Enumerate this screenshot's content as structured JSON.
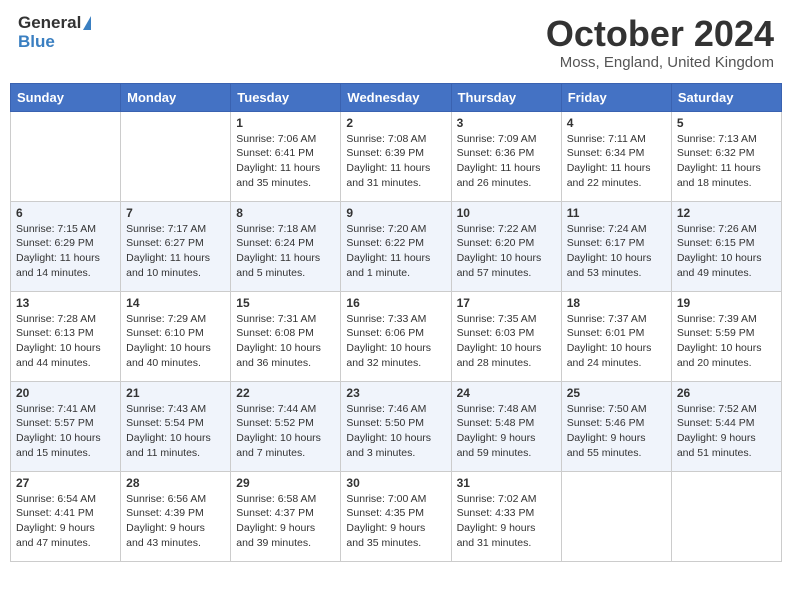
{
  "header": {
    "logo_general": "General",
    "logo_blue": "Blue",
    "title": "October 2024",
    "location": "Moss, England, United Kingdom"
  },
  "weekdays": [
    "Sunday",
    "Monday",
    "Tuesday",
    "Wednesday",
    "Thursday",
    "Friday",
    "Saturday"
  ],
  "weeks": [
    [
      {
        "day": "",
        "sunrise": "",
        "sunset": "",
        "daylight": ""
      },
      {
        "day": "",
        "sunrise": "",
        "sunset": "",
        "daylight": ""
      },
      {
        "day": "1",
        "sunrise": "Sunrise: 7:06 AM",
        "sunset": "Sunset: 6:41 PM",
        "daylight": "Daylight: 11 hours and 35 minutes."
      },
      {
        "day": "2",
        "sunrise": "Sunrise: 7:08 AM",
        "sunset": "Sunset: 6:39 PM",
        "daylight": "Daylight: 11 hours and 31 minutes."
      },
      {
        "day": "3",
        "sunrise": "Sunrise: 7:09 AM",
        "sunset": "Sunset: 6:36 PM",
        "daylight": "Daylight: 11 hours and 26 minutes."
      },
      {
        "day": "4",
        "sunrise": "Sunrise: 7:11 AM",
        "sunset": "Sunset: 6:34 PM",
        "daylight": "Daylight: 11 hours and 22 minutes."
      },
      {
        "day": "5",
        "sunrise": "Sunrise: 7:13 AM",
        "sunset": "Sunset: 6:32 PM",
        "daylight": "Daylight: 11 hours and 18 minutes."
      }
    ],
    [
      {
        "day": "6",
        "sunrise": "Sunrise: 7:15 AM",
        "sunset": "Sunset: 6:29 PM",
        "daylight": "Daylight: 11 hours and 14 minutes."
      },
      {
        "day": "7",
        "sunrise": "Sunrise: 7:17 AM",
        "sunset": "Sunset: 6:27 PM",
        "daylight": "Daylight: 11 hours and 10 minutes."
      },
      {
        "day": "8",
        "sunrise": "Sunrise: 7:18 AM",
        "sunset": "Sunset: 6:24 PM",
        "daylight": "Daylight: 11 hours and 5 minutes."
      },
      {
        "day": "9",
        "sunrise": "Sunrise: 7:20 AM",
        "sunset": "Sunset: 6:22 PM",
        "daylight": "Daylight: 11 hours and 1 minute."
      },
      {
        "day": "10",
        "sunrise": "Sunrise: 7:22 AM",
        "sunset": "Sunset: 6:20 PM",
        "daylight": "Daylight: 10 hours and 57 minutes."
      },
      {
        "day": "11",
        "sunrise": "Sunrise: 7:24 AM",
        "sunset": "Sunset: 6:17 PM",
        "daylight": "Daylight: 10 hours and 53 minutes."
      },
      {
        "day": "12",
        "sunrise": "Sunrise: 7:26 AM",
        "sunset": "Sunset: 6:15 PM",
        "daylight": "Daylight: 10 hours and 49 minutes."
      }
    ],
    [
      {
        "day": "13",
        "sunrise": "Sunrise: 7:28 AM",
        "sunset": "Sunset: 6:13 PM",
        "daylight": "Daylight: 10 hours and 44 minutes."
      },
      {
        "day": "14",
        "sunrise": "Sunrise: 7:29 AM",
        "sunset": "Sunset: 6:10 PM",
        "daylight": "Daylight: 10 hours and 40 minutes."
      },
      {
        "day": "15",
        "sunrise": "Sunrise: 7:31 AM",
        "sunset": "Sunset: 6:08 PM",
        "daylight": "Daylight: 10 hours and 36 minutes."
      },
      {
        "day": "16",
        "sunrise": "Sunrise: 7:33 AM",
        "sunset": "Sunset: 6:06 PM",
        "daylight": "Daylight: 10 hours and 32 minutes."
      },
      {
        "day": "17",
        "sunrise": "Sunrise: 7:35 AM",
        "sunset": "Sunset: 6:03 PM",
        "daylight": "Daylight: 10 hours and 28 minutes."
      },
      {
        "day": "18",
        "sunrise": "Sunrise: 7:37 AM",
        "sunset": "Sunset: 6:01 PM",
        "daylight": "Daylight: 10 hours and 24 minutes."
      },
      {
        "day": "19",
        "sunrise": "Sunrise: 7:39 AM",
        "sunset": "Sunset: 5:59 PM",
        "daylight": "Daylight: 10 hours and 20 minutes."
      }
    ],
    [
      {
        "day": "20",
        "sunrise": "Sunrise: 7:41 AM",
        "sunset": "Sunset: 5:57 PM",
        "daylight": "Daylight: 10 hours and 15 minutes."
      },
      {
        "day": "21",
        "sunrise": "Sunrise: 7:43 AM",
        "sunset": "Sunset: 5:54 PM",
        "daylight": "Daylight: 10 hours and 11 minutes."
      },
      {
        "day": "22",
        "sunrise": "Sunrise: 7:44 AM",
        "sunset": "Sunset: 5:52 PM",
        "daylight": "Daylight: 10 hours and 7 minutes."
      },
      {
        "day": "23",
        "sunrise": "Sunrise: 7:46 AM",
        "sunset": "Sunset: 5:50 PM",
        "daylight": "Daylight: 10 hours and 3 minutes."
      },
      {
        "day": "24",
        "sunrise": "Sunrise: 7:48 AM",
        "sunset": "Sunset: 5:48 PM",
        "daylight": "Daylight: 9 hours and 59 minutes."
      },
      {
        "day": "25",
        "sunrise": "Sunrise: 7:50 AM",
        "sunset": "Sunset: 5:46 PM",
        "daylight": "Daylight: 9 hours and 55 minutes."
      },
      {
        "day": "26",
        "sunrise": "Sunrise: 7:52 AM",
        "sunset": "Sunset: 5:44 PM",
        "daylight": "Daylight: 9 hours and 51 minutes."
      }
    ],
    [
      {
        "day": "27",
        "sunrise": "Sunrise: 6:54 AM",
        "sunset": "Sunset: 4:41 PM",
        "daylight": "Daylight: 9 hours and 47 minutes."
      },
      {
        "day": "28",
        "sunrise": "Sunrise: 6:56 AM",
        "sunset": "Sunset: 4:39 PM",
        "daylight": "Daylight: 9 hours and 43 minutes."
      },
      {
        "day": "29",
        "sunrise": "Sunrise: 6:58 AM",
        "sunset": "Sunset: 4:37 PM",
        "daylight": "Daylight: 9 hours and 39 minutes."
      },
      {
        "day": "30",
        "sunrise": "Sunrise: 7:00 AM",
        "sunset": "Sunset: 4:35 PM",
        "daylight": "Daylight: 9 hours and 35 minutes."
      },
      {
        "day": "31",
        "sunrise": "Sunrise: 7:02 AM",
        "sunset": "Sunset: 4:33 PM",
        "daylight": "Daylight: 9 hours and 31 minutes."
      },
      {
        "day": "",
        "sunrise": "",
        "sunset": "",
        "daylight": ""
      },
      {
        "day": "",
        "sunrise": "",
        "sunset": "",
        "daylight": ""
      }
    ]
  ]
}
